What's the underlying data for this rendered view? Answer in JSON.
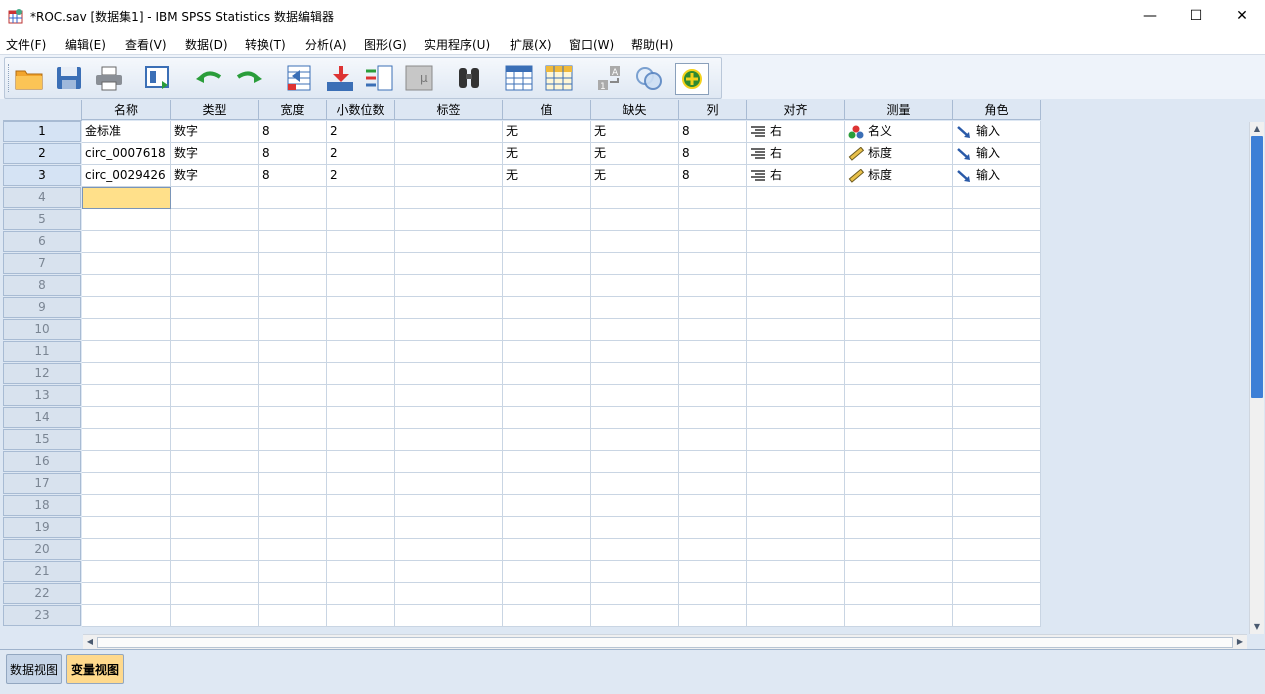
{
  "window": {
    "title": "*ROC.sav [数据集1] - IBM SPSS Statistics 数据编辑器",
    "minimize": "—",
    "maximize": "☐",
    "close": "✕"
  },
  "menu": [
    "文件(F)",
    "编辑(E)",
    "查看(V)",
    "数据(D)",
    "转换(T)",
    "分析(A)",
    "图形(G)",
    "实用程序(U)",
    "扩展(X)",
    "窗口(W)",
    "帮助(H)"
  ],
  "toolbar": {
    "buttons": [
      "open-folder-icon",
      "save-icon",
      "print-icon",
      "recall-dialog-icon",
      "undo-icon",
      "redo-icon",
      "goto-case-icon",
      "goto-variable-icon",
      "variables-icon",
      "run-descriptive-icon",
      "find-icon",
      "insert-cases-icon",
      "insert-variable-icon",
      "split-file-icon",
      "weight-cases-icon",
      "select-cases-icon",
      "value-labels-icon",
      "use-sets-icon",
      "show-all-variables-icon"
    ]
  },
  "grid": {
    "columns": [
      "名称",
      "类型",
      "宽度",
      "小数位数",
      "标签",
      "值",
      "缺失",
      "列",
      "对齐",
      "测量",
      "角色"
    ],
    "rows": [
      {
        "num": "1",
        "name": "金标准",
        "type": "数字",
        "width": "8",
        "decimals": "2",
        "label": "",
        "values": "无",
        "missing": "无",
        "columns": "8",
        "align": "右",
        "measure": "名义",
        "measure_icon": "nominal-icon",
        "role": "输入"
      },
      {
        "num": "2",
        "name": "circ_0007618",
        "type": "数字",
        "width": "8",
        "decimals": "2",
        "label": "",
        "values": "无",
        "missing": "无",
        "columns": "8",
        "align": "右",
        "measure": "标度",
        "measure_icon": "scale-icon",
        "role": "输入"
      },
      {
        "num": "3",
        "name": "circ_0029426",
        "type": "数字",
        "width": "8",
        "decimals": "2",
        "label": "",
        "values": "无",
        "missing": "无",
        "columns": "8",
        "align": "右",
        "measure": "标度",
        "measure_icon": "scale-icon",
        "role": "输入"
      }
    ],
    "empty_row_numbers": [
      "4",
      "5",
      "6",
      "7",
      "8",
      "9",
      "10",
      "11",
      "12",
      "13",
      "14",
      "15",
      "16",
      "17",
      "18",
      "19",
      "20",
      "21",
      "22",
      "23"
    ]
  },
  "tabs": {
    "data_view": "数据视图",
    "variable_view": "变量视图"
  },
  "colors": {
    "header_bg": "#dde7f3",
    "selected_cell": "#ffe08a",
    "active_tab": "#ffd98c",
    "scroll_thumb": "#3d7fd6"
  }
}
